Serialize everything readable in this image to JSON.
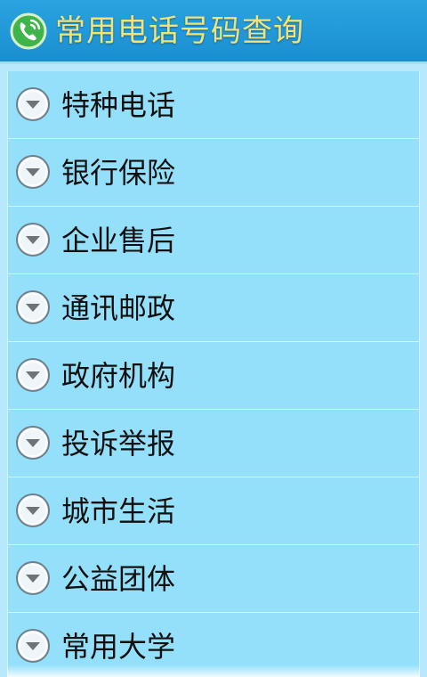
{
  "header": {
    "title": "常用电话号码查询",
    "icon": "phone-icon",
    "title_color": "#f2e27a",
    "bar_color": "#1a8fd0"
  },
  "list": {
    "background_color": "#94e0fa",
    "item_icon": "chevron-down-circle-icon",
    "items": [
      {
        "label": "特种电话"
      },
      {
        "label": "银行保险"
      },
      {
        "label": "企业售后"
      },
      {
        "label": "通讯邮政"
      },
      {
        "label": "政府机构"
      },
      {
        "label": "投诉举报"
      },
      {
        "label": "城市生活"
      },
      {
        "label": "公益团体"
      },
      {
        "label": "常用大学"
      }
    ]
  }
}
